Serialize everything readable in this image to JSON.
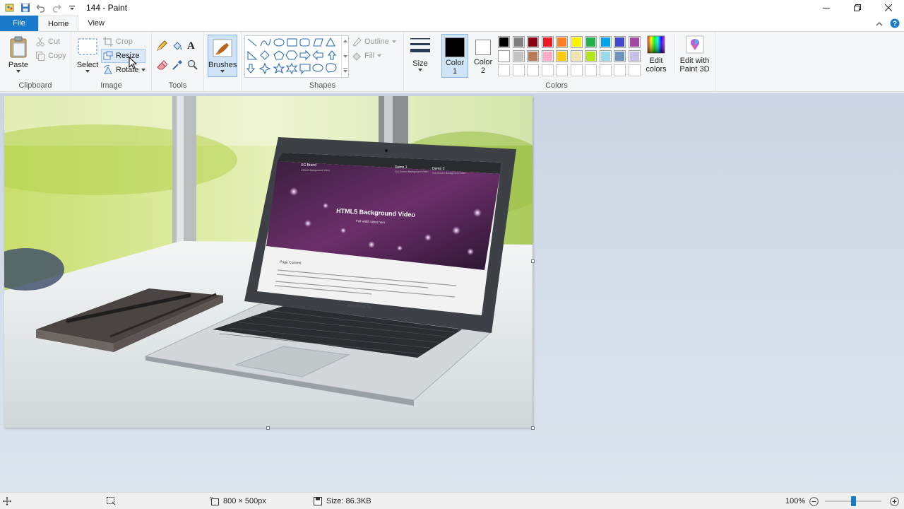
{
  "window": {
    "title": "144 - Paint"
  },
  "tabs": [
    {
      "label": "File"
    },
    {
      "label": "Home"
    },
    {
      "label": "View"
    }
  ],
  "clipboard": {
    "paste_label": "Paste",
    "cut_label": "Cut",
    "copy_label": "Copy",
    "group_label": "Clipboard"
  },
  "image_group": {
    "select_label": "Select",
    "crop_label": "Crop",
    "resize_label": "Resize",
    "rotate_label": "Rotate",
    "group_label": "Image"
  },
  "tools_group": {
    "group_label": "Tools",
    "text_tool_glyph": "A"
  },
  "brushes": {
    "label": "Brushes"
  },
  "shapes_group": {
    "outline_label": "Outline",
    "fill_label": "Fill",
    "group_label": "Shapes"
  },
  "size": {
    "label": "Size"
  },
  "colors_group": {
    "color1_label": "Color",
    "color1_num": "1",
    "color2_label": "Color",
    "color2_num": "2",
    "edit_colors_label_line1": "Edit",
    "edit_colors_label_line2": "colors",
    "edit_3d_label_line1": "Edit with",
    "edit_3d_label_line2": "Paint 3D",
    "group_label": "Colors",
    "color1": "#000000",
    "color2": "#ffffff",
    "row1": [
      "#000000",
      "#7f7f7f",
      "#880015",
      "#ed1c24",
      "#ff7f27",
      "#fff200",
      "#22b14c",
      "#00a2e8",
      "#3f48cc",
      "#a349a4"
    ],
    "row2": [
      "#ffffff",
      "#c3c3c3",
      "#b97a57",
      "#ffaec9",
      "#ffc90e",
      "#efe4b0",
      "#b5e61d",
      "#99d9ea",
      "#7092be",
      "#c8bfe7"
    ]
  },
  "screen_image": {
    "site_brand": "XG Brand",
    "site_brand_sub": "HTML5 Background Video",
    "demo1": "Demo 1",
    "demo1_sub": "Full-Screen Background Video",
    "demo2": "Demo 2",
    "demo2_sub": "Full-Screen Background Video",
    "hero_title": "HTML5 Background Video",
    "hero_sub": "Full width video hero",
    "content_title": "Page Content",
    "laptop_brand": "MacBook Air"
  },
  "status": {
    "dimensions": "800 × 500px",
    "size": "Size: 86.3KB",
    "zoom": "100%",
    "zoom_level": 100
  }
}
